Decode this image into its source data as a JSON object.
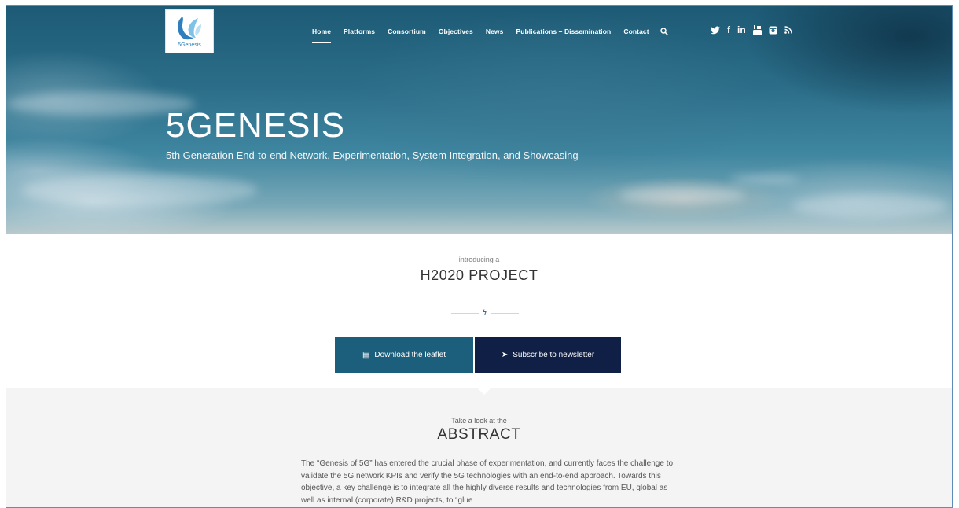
{
  "brand": {
    "logo_text": "5Genesis"
  },
  "nav": {
    "items": [
      {
        "label": "Home",
        "active": true
      },
      {
        "label": "Platforms",
        "active": false
      },
      {
        "label": "Consortium",
        "active": false
      },
      {
        "label": "Objectives",
        "active": false
      },
      {
        "label": "News",
        "active": false
      },
      {
        "label": "Publications – Dissemination",
        "active": false
      },
      {
        "label": "Contact",
        "active": false
      }
    ],
    "search_icon": "search-icon"
  },
  "social": [
    "twitter-icon",
    "facebook-icon",
    "linkedin-icon",
    "youtube-icon",
    "instagram-icon",
    "rss-icon"
  ],
  "hero": {
    "title": "5GENESIS",
    "subtitle": "5th Generation End-to-end Network, Experimentation, System Integration, and Showcasing"
  },
  "intro": {
    "kicker": "introducing a",
    "heading": "H2020 PROJECT",
    "buttons": {
      "download_label": "Download the leaflet",
      "subscribe_label": "Subscribe to newsletter"
    }
  },
  "abstract": {
    "kicker": "Take a look at the",
    "heading": "ABSTRACT",
    "body": "The “Genesis of 5G” has entered the crucial phase of experimentation, and currently faces the challenge to validate the 5G network KPIs and verify the 5G technologies with an end-to-end approach. Towards this objective, a key challenge is to integrate all the highly diverse results and technologies from EU, global as well as internal (corporate) R&D projects, to “glue"
  },
  "colors": {
    "download_button": "#1c5f7c",
    "subscribe_button": "#0f1f45",
    "accent": "#2b6fa0"
  }
}
